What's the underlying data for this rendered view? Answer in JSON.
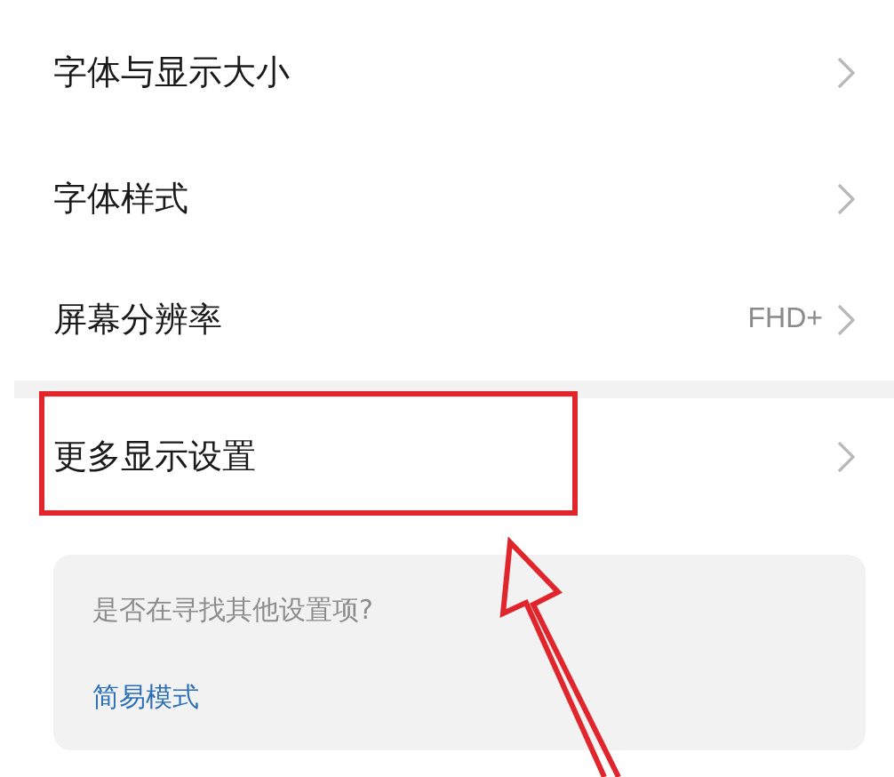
{
  "settings_rows": [
    {
      "label": "字体与显示大小"
    },
    {
      "label": "字体样式"
    },
    {
      "label": "屏幕分辨率",
      "value": "FHD+"
    }
  ],
  "more_row": {
    "label": "更多显示设置"
  },
  "suggestion_card": {
    "question": "是否在寻找其他设置项?",
    "link": "简易模式"
  }
}
